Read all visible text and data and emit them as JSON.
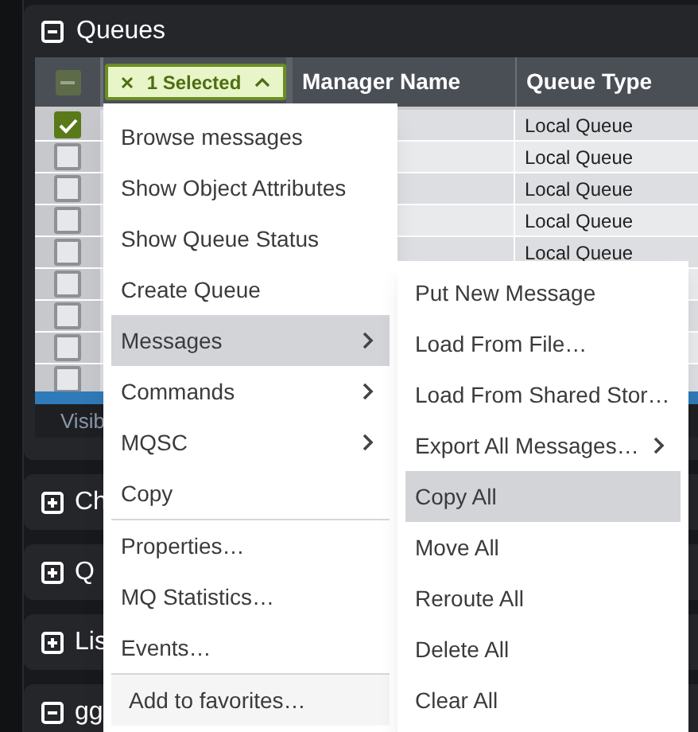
{
  "queues_panel": {
    "title": "Queues",
    "expanded": true,
    "table": {
      "select_all_partial": true,
      "selection_chip": {
        "label": "1 Selected"
      },
      "columns": [
        "Manager Name",
        "Queue Type"
      ],
      "rows": [
        {
          "checked": true,
          "queue_type": "Local Queue"
        },
        {
          "checked": false,
          "queue_type": "Local Queue"
        },
        {
          "checked": false,
          "queue_type": "Local Queue"
        },
        {
          "checked": false,
          "queue_type": "Local Queue"
        },
        {
          "checked": false,
          "queue_type": "Local Queue"
        },
        {
          "checked": false
        },
        {
          "checked": false
        },
        {
          "checked": false
        },
        {
          "checked": false
        }
      ],
      "footer": "Visib"
    }
  },
  "other_panels": [
    {
      "title": "Ch",
      "expanded": false
    },
    {
      "title": "Q",
      "expanded": false
    },
    {
      "title": "Lis",
      "expanded": false
    },
    {
      "title": "gg",
      "expanded": true
    }
  ],
  "context_menu": {
    "items": [
      {
        "kind": "item",
        "label": "Browse messages",
        "selected": false
      },
      {
        "kind": "item",
        "label": "Show Object Attributes",
        "selected": false
      },
      {
        "kind": "item",
        "label": "Show Queue Status",
        "selected": false
      },
      {
        "kind": "item",
        "label": "Create Queue",
        "selected": false
      },
      {
        "kind": "submenu",
        "label": "Messages",
        "selected": true
      },
      {
        "kind": "submenu",
        "label": "Commands",
        "selected": false
      },
      {
        "kind": "submenu",
        "label": "MQSC",
        "selected": false
      },
      {
        "kind": "item",
        "label": "Copy",
        "selected": false
      },
      {
        "kind": "separator"
      },
      {
        "kind": "item",
        "label": "Properties…",
        "selected": false
      },
      {
        "kind": "item",
        "label": "MQ Statistics…",
        "selected": false
      },
      {
        "kind": "item",
        "label": "Events…",
        "selected": false
      },
      {
        "kind": "separator"
      },
      {
        "kind": "footer",
        "label": "Add to favorites…",
        "selected": false
      }
    ]
  },
  "submenu": {
    "items": [
      {
        "kind": "item",
        "label": "Put New Message",
        "selected": false
      },
      {
        "kind": "item",
        "label": "Load From File…",
        "selected": false
      },
      {
        "kind": "item",
        "label": "Load From Shared Stor…",
        "selected": false
      },
      {
        "kind": "submenu",
        "label": "Export All Messages…",
        "selected": false
      },
      {
        "kind": "item",
        "label": "Copy All",
        "selected": true
      },
      {
        "kind": "item",
        "label": "Move All",
        "selected": false
      },
      {
        "kind": "item",
        "label": "Reroute All",
        "selected": false
      },
      {
        "kind": "item",
        "label": "Delete All",
        "selected": false
      },
      {
        "kind": "item",
        "label": "Clear All",
        "selected": false
      }
    ]
  }
}
